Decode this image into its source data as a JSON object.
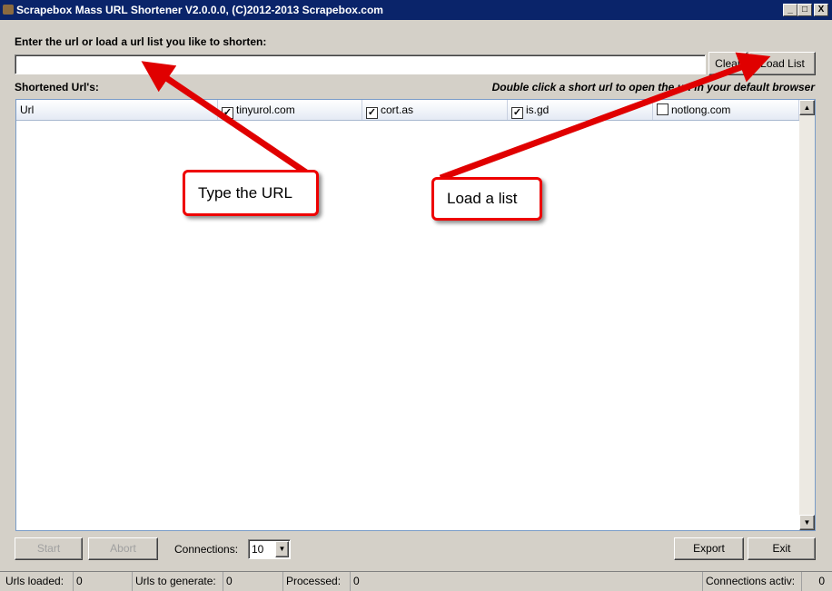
{
  "window": {
    "title": "Scrapebox Mass URL Shortener V2.0.0.0, (C)2012-2013 Scrapebox.com",
    "minimize": "_",
    "maximize": "□",
    "close": "X"
  },
  "input": {
    "label": "Enter the url or load a url list you like to shorten:",
    "value": "",
    "clear_label": "Clear",
    "load_list_label": "Load List"
  },
  "results": {
    "label": "Shortened Url's:",
    "hint": "Double click a short url to open the url in your default browser",
    "columns": [
      {
        "label": "Url"
      },
      {
        "label": "tinyurol.com",
        "checked": true
      },
      {
        "label": "cort.as",
        "checked": true
      },
      {
        "label": "is.gd",
        "checked": true
      },
      {
        "label": "notlong.com",
        "checked": false
      }
    ]
  },
  "footer": {
    "start_label": "Start",
    "abort_label": "Abort",
    "connections_label": "Connections:",
    "connections_value": "10",
    "export_label": "Export",
    "exit_label": "Exit"
  },
  "status": {
    "urls_loaded_label": "Urls loaded:",
    "urls_loaded": "0",
    "urls_to_generate_label": "Urls to generate:",
    "urls_to_generate": "0",
    "processed_label": "Processed:",
    "processed": "0",
    "connections_active_label": "Connections activ:",
    "connections_active": "0"
  },
  "annotations": {
    "type_url": "Type the URL",
    "load_list": "Load a list",
    "arrow_color": "#e00000"
  }
}
